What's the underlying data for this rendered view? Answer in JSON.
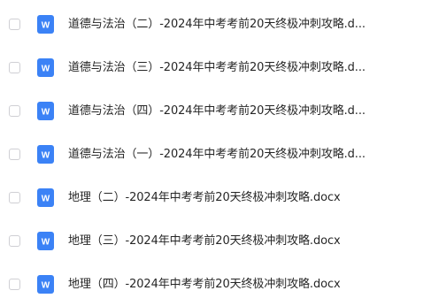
{
  "file_list": {
    "icon_type": "word-doc-icon",
    "icon_color": "#3b82f6",
    "items": [
      {
        "name": "道德与法治（二）-2024年中考考前20天终极冲刺攻略.d...",
        "selected": false
      },
      {
        "name": "道德与法治（三）-2024年中考考前20天终极冲刺攻略.d...",
        "selected": false
      },
      {
        "name": "道德与法治（四）-2024年中考考前20天终极冲刺攻略.d...",
        "selected": false
      },
      {
        "name": "道德与法治（一）-2024年中考考前20天终极冲刺攻略.d...",
        "selected": false
      },
      {
        "name": "地理（二）-2024年中考考前20天终极冲刺攻略.docx",
        "selected": false
      },
      {
        "name": "地理（三）-2024年中考考前20天终极冲刺攻略.docx",
        "selected": false
      },
      {
        "name": "地理（四）-2024年中考考前20天终极冲刺攻略.docx",
        "selected": false
      }
    ]
  }
}
